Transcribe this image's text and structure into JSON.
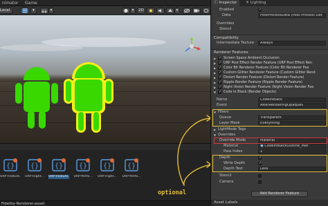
{
  "tabs": {
    "animator": "nimator",
    "game": "Game"
  },
  "scene_toolbar": {
    "mode": "Local",
    "view2d": "2D"
  },
  "project": {
    "assets": [
      {
        "label": "URP-Feature..."
      },
      {
        "label": "URP-HighF..."
      },
      {
        "label": "URP-Feature..."
      },
      {
        "label": "URP-Perfo..."
      },
      {
        "label": "URP-HighF..."
      },
      {
        "label": "URP-Perfo..."
      }
    ],
    "bottom_path": "Fidelity-Renderer.asset"
  },
  "annotation": "optional",
  "colors": {
    "highlight": "#e8c13a",
    "selected_mode": "#d43c3c",
    "char_green": "#39d800",
    "char_outline": "#f3ef16"
  },
  "inspector": {
    "tabs": {
      "inspector": "Inspector",
      "lighting": "Lighting"
    },
    "top_rows": [
      {
        "label": "Enabled",
        "checked": true
      },
      {
        "label": "Data",
        "value": "PostProcessData (Post Process Dat"
      }
    ],
    "overrides_label": "Overrides",
    "stencil_label": "Stencil",
    "compatibility": {
      "title": "Compatibility",
      "label": "Intermediate Texture",
      "value": "Always"
    },
    "renderer_features": {
      "title": "Renderer Features",
      "items": [
        "Screen Space Ambient Occlusion",
        "URP Post Effect Render Feature (URP Post Effect Ren",
        "Color Bit Renderer Feature (Color Bit Renderer Fea",
        "Custom Glitter Renderer Feature (Custom Glitter Rend",
        "Distort Render Feature (Distort Render Feature)",
        "Ripple Render Feature (Ripple Render Feature)",
        "Night Vision Render Feature (Night Vision Render Fea",
        "Code In Black (Render Objects)"
      ]
    },
    "code_in_black": {
      "name_label": "Name",
      "name_value": "CodeInBlack",
      "event_label": "Event",
      "event_value": "AfterRenderingOpaques",
      "filters": "Filters",
      "queue_label": "Queue",
      "queue_value": "Transparent",
      "layer_mask_label": "Layer Mask",
      "layer_mask_value": "Everything",
      "lightmode_tags": "LightMode Tags",
      "overrides": "Overrides",
      "override_mode_label": "Override Mode",
      "override_mode_value": "Material",
      "material_label": "Material",
      "material_value": "CodeInBlackOutline_Mat",
      "pass_index_label": "Pass Index",
      "pass_index_value": "1",
      "depth": "Depth",
      "write_depth_label": "Write Depth",
      "depth_test_label": "Depth Test",
      "depth_test_value": "Less",
      "stencil": "Stencil",
      "camera": "Camera"
    },
    "add_button": "Add Renderer Feature",
    "asset_labels": "Asset Labels"
  }
}
